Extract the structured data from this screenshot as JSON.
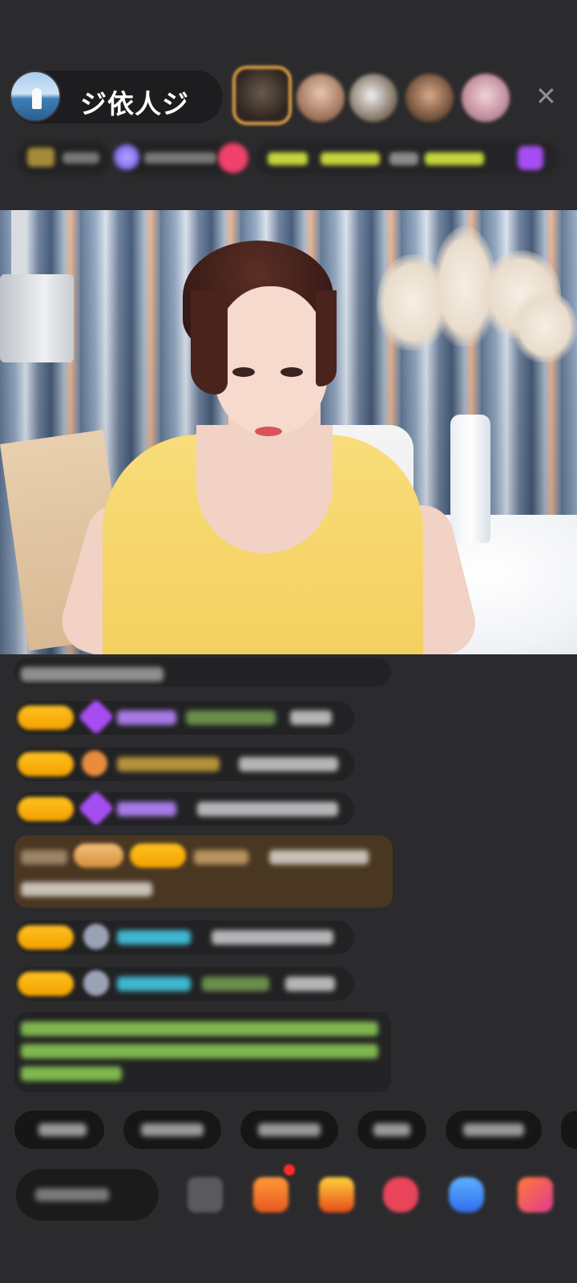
{
  "header": {
    "host_name": "ジ依人ジ",
    "close_icon": "close-icon"
  },
  "colors": {
    "background": "#2b2b2d",
    "badge_gold": "#ffc11f",
    "purple_gem": "#a64df2",
    "cyan_name": "#3fb6cf",
    "green_system": "#8fcf5a"
  }
}
